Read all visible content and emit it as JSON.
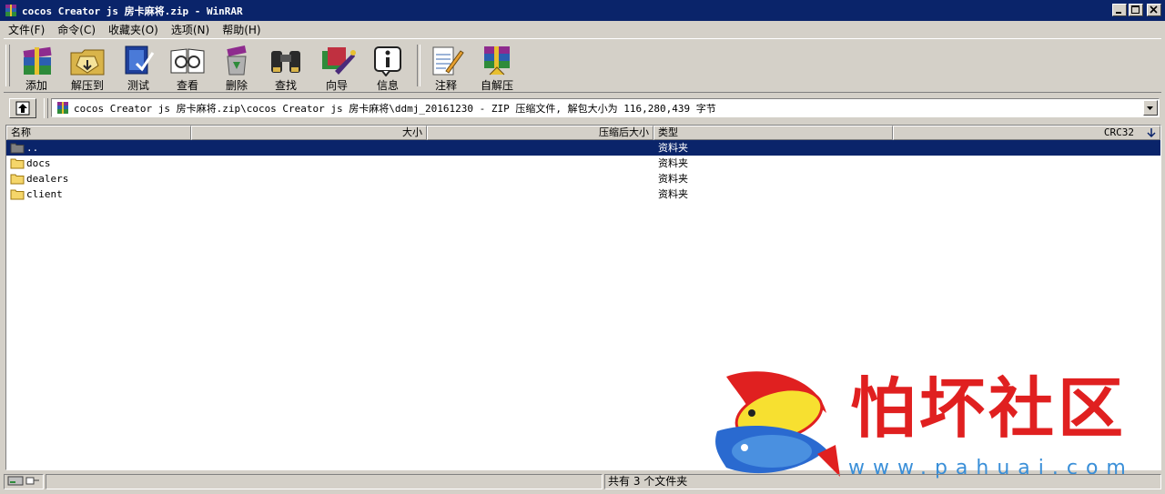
{
  "window": {
    "title": "cocos Creator js 房卡麻将.zip - WinRAR"
  },
  "menu": [
    {
      "label": "文件(F)"
    },
    {
      "label": "命令(C)"
    },
    {
      "label": "收藏夹(O)"
    },
    {
      "label": "选项(N)"
    },
    {
      "label": "帮助(H)"
    }
  ],
  "toolbar": {
    "add": "添加",
    "extract_to": "解压到",
    "test": "测试",
    "view": "查看",
    "delete": "删除",
    "find": "查找",
    "wizard": "向导",
    "info": "信息",
    "comment": "注释",
    "sfx": "自解压"
  },
  "address": {
    "path": "cocos Creator js 房卡麻将.zip\\cocos Creator js 房卡麻将\\ddmj_20161230 - ZIP 压缩文件, 解包大小为 116,280,439 字节"
  },
  "columns": {
    "name": "名称",
    "size": "大小",
    "packed": "压缩后大小",
    "type": "类型",
    "crc": "CRC32"
  },
  "rows": [
    {
      "name": "..",
      "type": "资料夹"
    },
    {
      "name": "docs",
      "type": "资料夹"
    },
    {
      "name": "dealers",
      "type": "资料夹"
    },
    {
      "name": "client",
      "type": "资料夹"
    }
  ],
  "status": {
    "total": "共有 3 个文件夹"
  },
  "watermark": {
    "title": "怕坏社区",
    "url": "www.pahuai.com"
  },
  "colors": {
    "titlebar": "#0a246a",
    "selection": "#0a246a",
    "face": "#d4d0c8",
    "watermark_red": "#e02020",
    "watermark_blue": "#3a8fd8"
  }
}
